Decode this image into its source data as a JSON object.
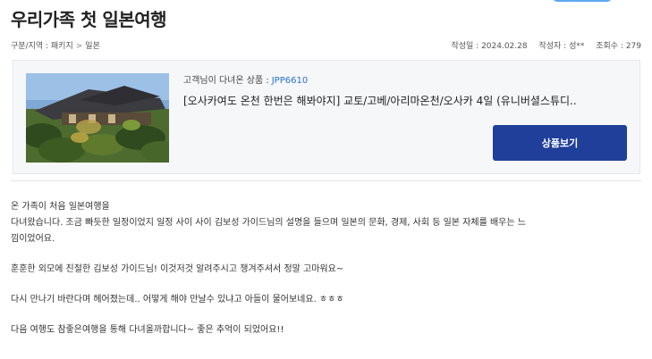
{
  "post": {
    "title": "우리가족 첫 일본여행",
    "breadcrumb": [
      "구분/지역 : 패키지",
      "일본"
    ],
    "meta": {
      "date": "작성일 : 2024.02.28",
      "author": "작성자 : 성**",
      "views": "조회수 : 279"
    }
  },
  "product_card": {
    "customer_label": "고객님이 다녀온 상품 :",
    "product_code": "JPP6610",
    "product_title": "[오사카여도 온천 한번은 해봐야지] 교토/고베/아리마온천/오사카 4일 (유니버셜스튜디..",
    "view_button": "상품보기",
    "thumbnail_icon": "japanese-garden-photo"
  },
  "content": {
    "paragraphs": [
      [
        "온 가족이 처음 일본여행을",
        "다녀왔습니다. 조금 빠듯한 일정이었지 일정 사이 사이 김보성 가이드님의 설명을 들으며 일본의 문화, 경제, 사회 등 일본 자체를 배우는 느",
        "낌이었어요."
      ],
      [
        "훈훈한 외모에 친절한 김보성 가이드님! 이것저것 알려주시고 챙겨주셔서 정말 고마워요~"
      ],
      [
        "다시 만나기 바란다며 헤어졌는데.. 어떻게 해야 만날수 있냐고 아들이 물어보네요. ㅎㅎㅎ"
      ],
      [
        "다음 여행도 참좋은여행을 통해 다녀올까합니다~ 좋은 추억이 되었어요!!"
      ]
    ]
  },
  "colors": {
    "accent_blue": "#1f3f9a",
    "code_blue": "#2b6fd0",
    "card_bg": "#f6f7f9"
  }
}
